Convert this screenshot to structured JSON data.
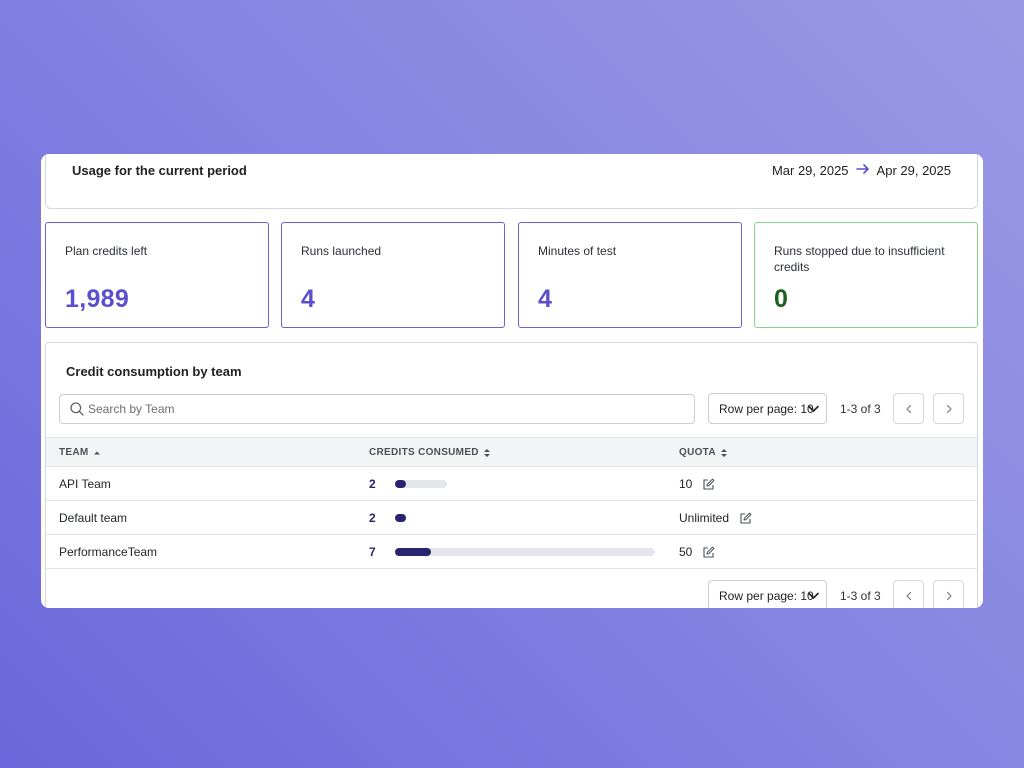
{
  "period": {
    "title": "Usage for the current period",
    "start": "Mar 29, 2025",
    "end": "Apr 29, 2025"
  },
  "cards": [
    {
      "label": "Plan credits left",
      "value": "1,989"
    },
    {
      "label": "Runs launched",
      "value": "4"
    },
    {
      "label": "Minutes of test",
      "value": "4"
    },
    {
      "label": "Runs stopped due to insufficient credits",
      "value": "0"
    }
  ],
  "teams": {
    "title": "Credit consumption by team",
    "search_placeholder": "Search by Team",
    "rows_per_page_label": "Row per page: 10",
    "range_label": "1-3 of 3",
    "columns": {
      "team": "TEAM",
      "credits": "CREDITS CONSUMED",
      "quota": "QUOTA"
    },
    "rows": [
      {
        "team": "API Team",
        "credits": "2",
        "quota": "10",
        "consumption_fraction": 0.2
      },
      {
        "team": "Default team",
        "credits": "2",
        "quota": "Unlimited",
        "consumption_fraction": null
      },
      {
        "team": "PerformanceTeam",
        "credits": "7",
        "quota": "50",
        "consumption_fraction": 0.14
      }
    ]
  },
  "colors": {
    "accent": "#5b4fcf",
    "bar": "#2a2470",
    "success": "#1c5f1f"
  },
  "icons": [
    "search-icon",
    "arrow-right-icon",
    "chevron-down-icon",
    "chevron-left-icon",
    "chevron-right-icon",
    "sort-asc-icon",
    "sort-icon",
    "edit-icon"
  ]
}
